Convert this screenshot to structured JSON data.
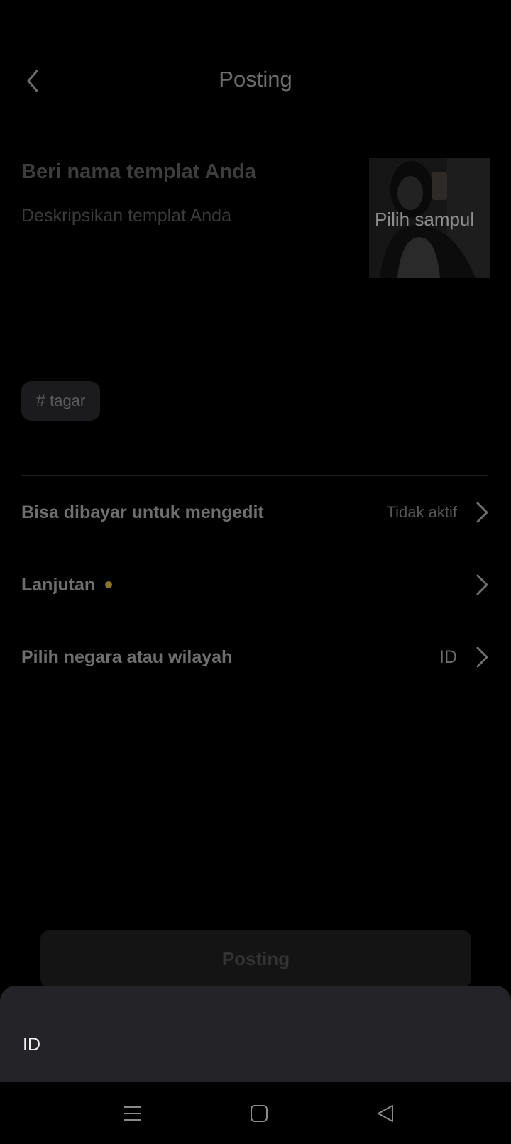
{
  "header": {
    "title": "Posting",
    "back_icon": "chevron-left-icon"
  },
  "template": {
    "name_placeholder": "Beri nama templat Anda",
    "desc_placeholder": "Deskripsikan templat Anda",
    "cover_label": "Pilih sampul"
  },
  "hashtag": {
    "symbol": "#",
    "label": "tagar"
  },
  "settings": [
    {
      "label": "Bisa dibayar untuk mengedit",
      "value": "Tidak aktif"
    },
    {
      "label": "Lanjutan",
      "value": ""
    },
    {
      "label": "Pilih negara atau wilayah",
      "value": "ID"
    }
  ],
  "post_button": {
    "label": "Posting"
  },
  "sheet": {
    "options": [
      "ID"
    ]
  },
  "colors": {
    "background": "#000000",
    "sheet": "#242428",
    "dot": "#8a7425"
  },
  "navbar": {
    "icons": [
      "menu-icon",
      "home-square-icon",
      "back-triangle-icon"
    ]
  }
}
